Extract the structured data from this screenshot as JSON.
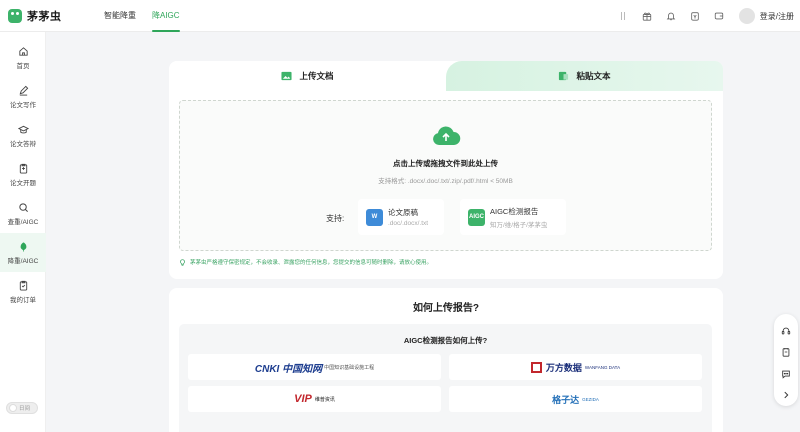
{
  "app": {
    "logo_text": "茅茅虫",
    "nav_tabs": [
      "智能降重",
      "降AIGC"
    ],
    "active_tab": "降AIGC",
    "login_label": "登录/注册"
  },
  "sidebar": {
    "items": [
      {
        "label": "首页",
        "icon": "home-icon"
      },
      {
        "label": "论文写作",
        "icon": "pen-icon"
      },
      {
        "label": "论文答辩",
        "icon": "graduation-cap-icon"
      },
      {
        "label": "论文开题",
        "icon": "clipboard-icon"
      },
      {
        "label": "查重/AIGC",
        "icon": "search-icon"
      },
      {
        "label": "降重/AIGC",
        "icon": "leaf-icon"
      },
      {
        "label": "我的订单",
        "icon": "order-icon"
      }
    ],
    "active_index": 5,
    "theme_toggle_label": "日间"
  },
  "upload": {
    "tab_upload": "上传文档",
    "tab_paste": "粘贴文本",
    "dropzone_title": "点击上传或拖拽文件到此处上传",
    "formats": "支持格式: .docx/.doc/.txt/.zip/.pdf/.html < 50MB",
    "support_label": "支持:",
    "cards": [
      {
        "name": "论文原稿",
        "sub": ".doc/.docx/.txt",
        "icon": "word-doc-icon"
      },
      {
        "name": "AIGC检测报告",
        "sub": "知万/维/格子/茅茅虫",
        "icon": "aigc-report-icon"
      }
    ],
    "notice": "茅茅虫严格遵守保密规定，不会收录、泄露您的任何信息，您提交的信息可随时删除，请放心使用。"
  },
  "howto": {
    "title": "如何上传报告?",
    "subtitle": "AIGC检测报告如何上传?",
    "sources": [
      {
        "name": "cnki",
        "text": "CNKI 中国知网",
        "sub": "中国知识基础设施工程"
      },
      {
        "name": "wanfang",
        "text": "万方数据",
        "sub": "WANFANG DATA"
      },
      {
        "name": "vip",
        "text": "VIP",
        "sub": "维普资讯"
      },
      {
        "name": "gezida",
        "text": "格子达",
        "sub": "GEZIDA"
      }
    ]
  },
  "colors": {
    "accent": "#2fa65a",
    "tab_paste_bg": "#d6f2e1",
    "notice": "#3aa363"
  }
}
